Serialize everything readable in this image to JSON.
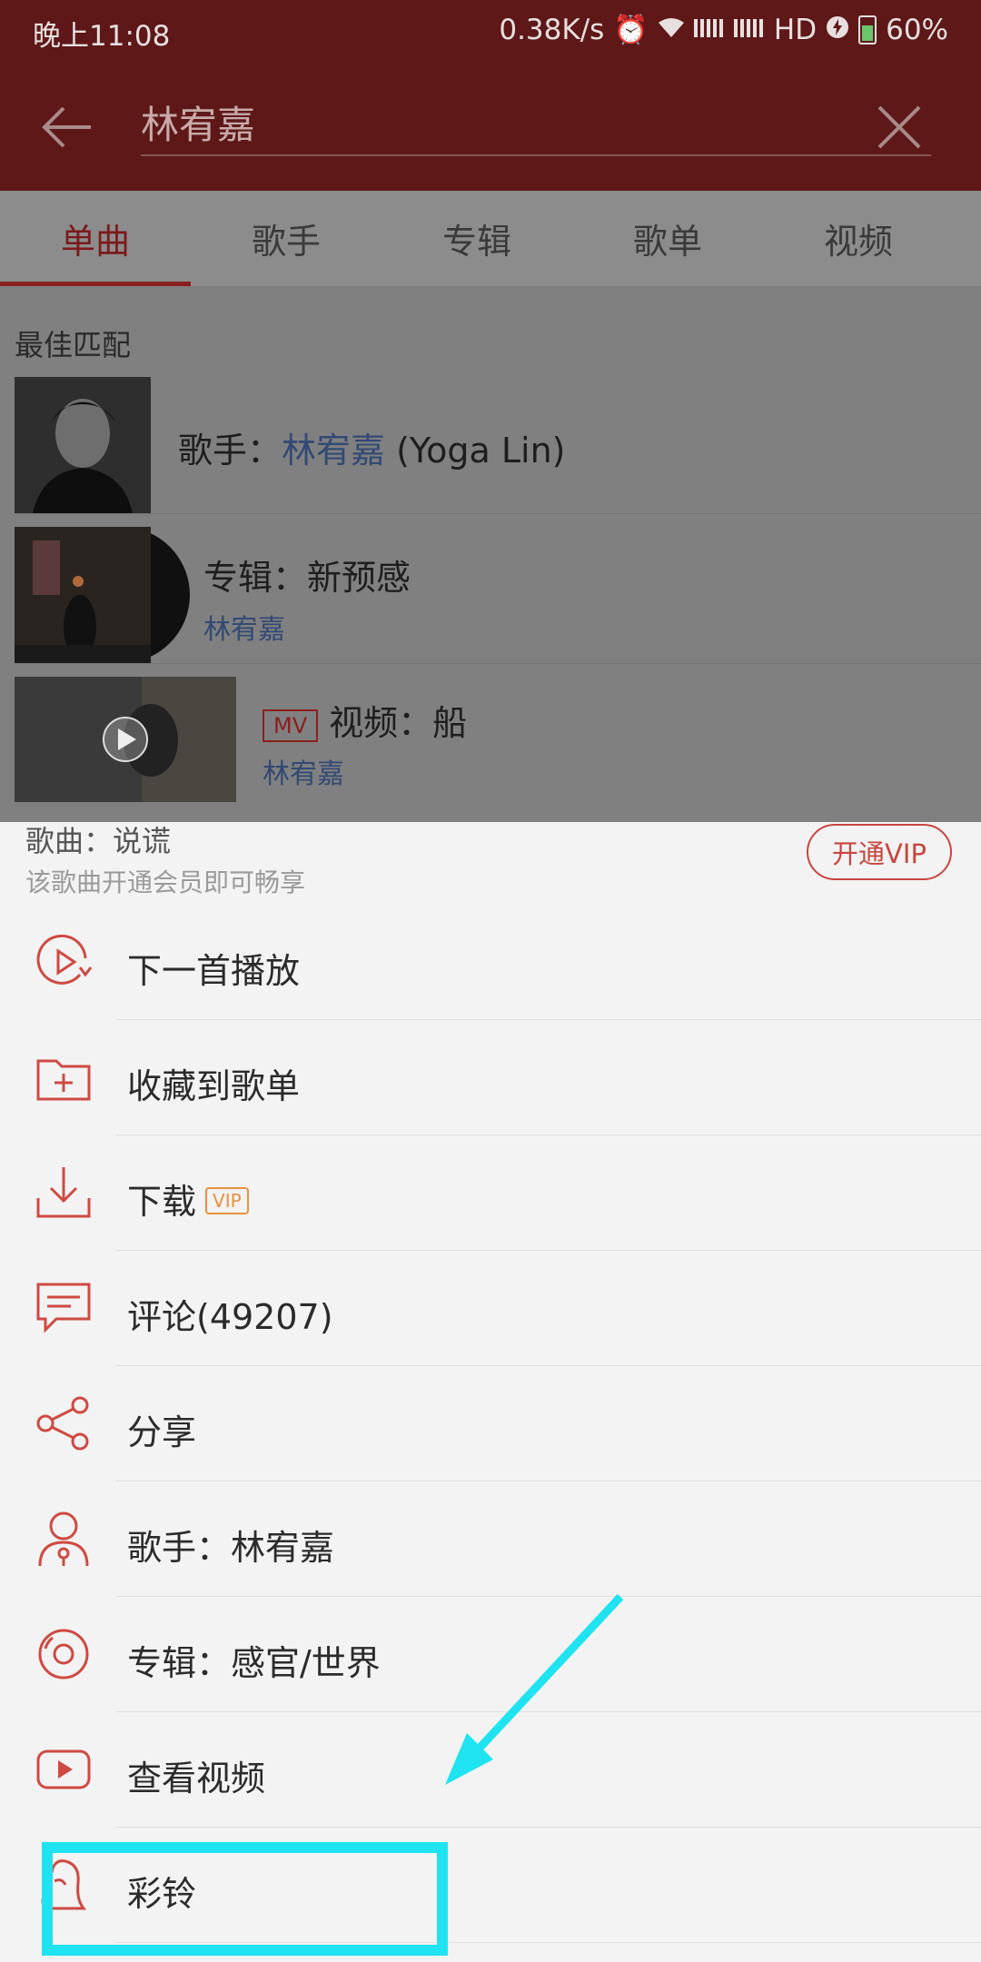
{
  "status_bar": {
    "time": "晚上11:08",
    "speed": "0.38K/s",
    "network": "HD",
    "battery": "60%"
  },
  "header": {
    "search_value": "林宥嘉"
  },
  "tabs": [
    {
      "label": "单曲",
      "active": true
    },
    {
      "label": "歌手",
      "active": false
    },
    {
      "label": "专辑",
      "active": false
    },
    {
      "label": "歌单",
      "active": false
    },
    {
      "label": "视频",
      "active": false
    }
  ],
  "results": {
    "best_match_label": "最佳匹配",
    "artist": {
      "prefix": "歌手：",
      "name": "林宥嘉",
      "suffix": " (Yoga Lin)"
    },
    "album": {
      "title": "专辑：新预感",
      "artist": "林宥嘉"
    },
    "video": {
      "badge": "MV",
      "title": "视频：船",
      "artist": "林宥嘉"
    }
  },
  "sheet": {
    "song_title": "歌曲：说谎",
    "song_note": "该歌曲开通会员即可畅享",
    "vip_button": "开通VIP",
    "menu": [
      {
        "label": "下一首播放",
        "icon": "play-next-icon"
      },
      {
        "label": "收藏到歌单",
        "icon": "folder-add-icon"
      },
      {
        "label": "下载",
        "icon": "download-icon",
        "tag": "VIP"
      },
      {
        "label": "评论(49207)",
        "icon": "comment-icon"
      },
      {
        "label": "分享",
        "icon": "share-icon"
      },
      {
        "label": "歌手：林宥嘉",
        "icon": "singer-icon"
      },
      {
        "label": "专辑：感官/世界",
        "icon": "album-icon"
      },
      {
        "label": "查看视频",
        "icon": "video-icon"
      },
      {
        "label": "彩铃",
        "icon": "ringtone-icon"
      }
    ]
  },
  "colors": {
    "header_bg": "#5e1818",
    "accent_red": "#c7463e",
    "annotation_cyan": "#1fe3f0"
  }
}
